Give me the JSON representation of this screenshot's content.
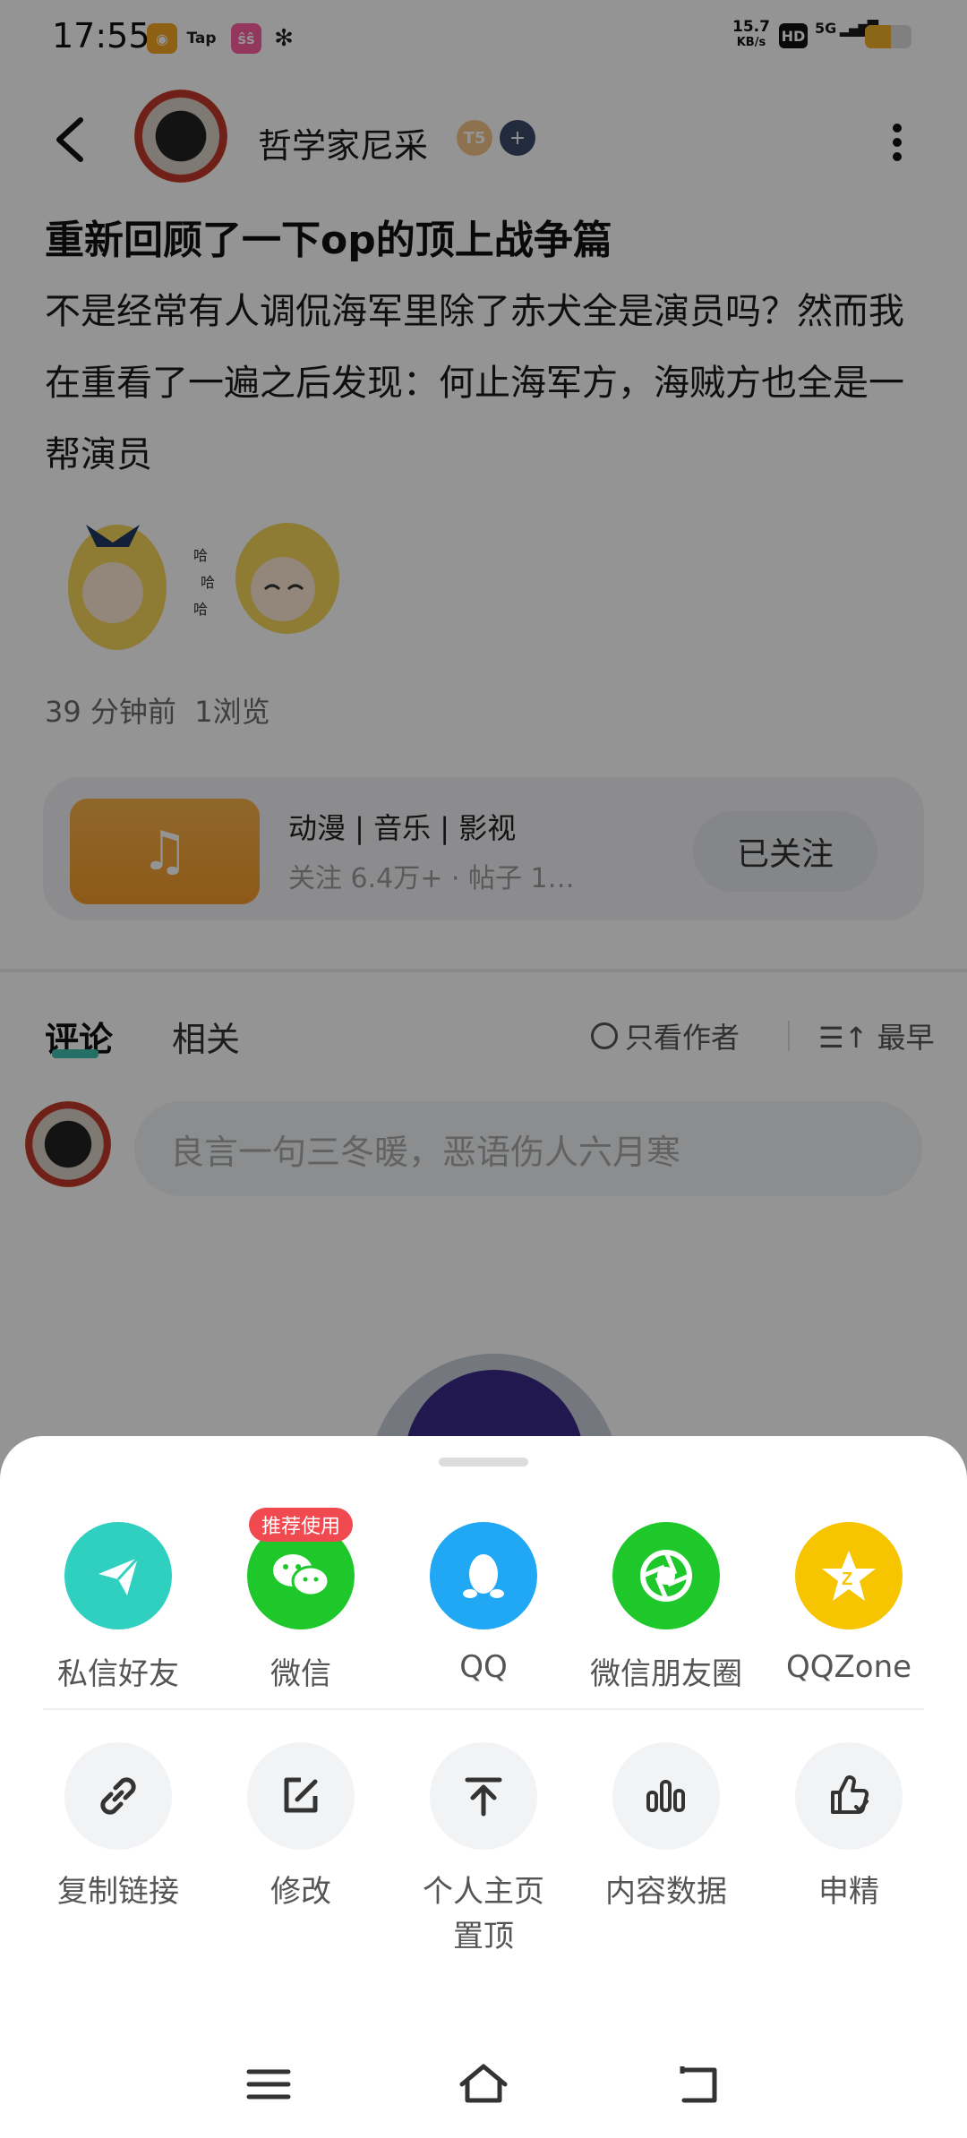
{
  "status_bar": {
    "time": "17:55",
    "apps": [
      {
        "name": "weibo-icon",
        "label": "",
        "color": "#f5a623"
      },
      {
        "name": "taptap-icon",
        "label": "Tap",
        "color": "#2a2a2a"
      },
      {
        "name": "app-icon",
        "label": "ŝŝ",
        "color": "#ff5fa2"
      },
      {
        "name": "wechat-icon",
        "label": "",
        "color": "#2a2a2a"
      }
    ],
    "net_speed": "15.7",
    "net_unit": "KB/s",
    "hd": "HD",
    "signal": "5G",
    "battery_level": 0.55
  },
  "header": {
    "author": "哲学家尼采",
    "level_badge": "T5"
  },
  "post": {
    "title": "重新回顾了一下op的顶上战争篇",
    "body": "不是经常有人调侃海军里除了赤犬全是演员吗？然而我在重看了一遍之后发现：何止海军方，海贼方也全是一帮演员",
    "time": "39 分钟前",
    "views": "1浏览"
  },
  "circle_card": {
    "name": "动漫 | 音乐 | 影视",
    "stats": "关注 6.4万+   ·   帖子 1…",
    "follow_label": "已关注"
  },
  "comments": {
    "tab_comment": "评论",
    "tab_related": "相关",
    "author_only": "只看作者",
    "sort": "最早",
    "input_placeholder": "良言一句三冬暖，恶语伤人六月寒"
  },
  "share_sheet": {
    "badge": "推荐使用",
    "targets": [
      {
        "label": "私信好友",
        "color": "#2fd0c0",
        "icon": "paper-plane-icon"
      },
      {
        "label": "微信",
        "color": "#1ec82a",
        "icon": "wechat-icon"
      },
      {
        "label": "QQ",
        "color": "#20a8f5",
        "icon": "qq-penguin-icon"
      },
      {
        "label": "微信朋友圈",
        "color": "#1ec82a",
        "icon": "moments-aperture-icon"
      },
      {
        "label": "QQZone",
        "color": "#f7c500",
        "icon": "qzone-star-icon"
      }
    ],
    "actions": [
      {
        "label": "复制链接",
        "icon": "link-icon"
      },
      {
        "label": "修改",
        "icon": "edit-icon"
      },
      {
        "label": "个人主页\n置顶",
        "icon": "pin-to-top-icon"
      },
      {
        "label": "内容数据",
        "icon": "bar-chart-icon"
      },
      {
        "label": "申精",
        "icon": "thumbs-up-icon"
      }
    ]
  }
}
